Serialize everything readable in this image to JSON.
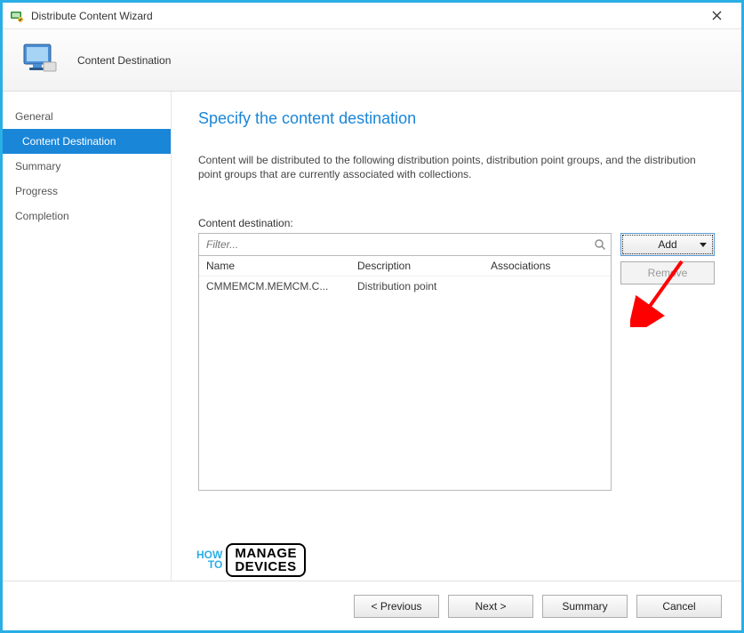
{
  "window": {
    "title": "Distribute Content Wizard"
  },
  "header": {
    "title": "Content Destination"
  },
  "sidebar": {
    "items": [
      {
        "label": "General",
        "active": false,
        "indent": false
      },
      {
        "label": "Content Destination",
        "active": true,
        "indent": true
      },
      {
        "label": "Summary",
        "active": false,
        "indent": false
      },
      {
        "label": "Progress",
        "active": false,
        "indent": false
      },
      {
        "label": "Completion",
        "active": false,
        "indent": false
      }
    ]
  },
  "page": {
    "heading": "Specify the content destination",
    "description": "Content will be distributed to the following distribution points, distribution point groups, and the distribution point groups that are currently associated with collections.",
    "field_label": "Content destination:"
  },
  "filter": {
    "placeholder": "Filter..."
  },
  "grid": {
    "columns": {
      "name": "Name",
      "description": "Description",
      "associations": "Associations"
    },
    "rows": [
      {
        "name": "CMMEMCM.MEMCM.C...",
        "description": "Distribution point",
        "associations": ""
      }
    ]
  },
  "side_buttons": {
    "add": "Add",
    "remove": "Remove"
  },
  "footer": {
    "previous": "< Previous",
    "next": "Next >",
    "summary": "Summary",
    "cancel": "Cancel"
  },
  "watermark": {
    "how": "HOW",
    "to": "TO",
    "manage": "MANAGE",
    "devices": "DEVICES"
  }
}
